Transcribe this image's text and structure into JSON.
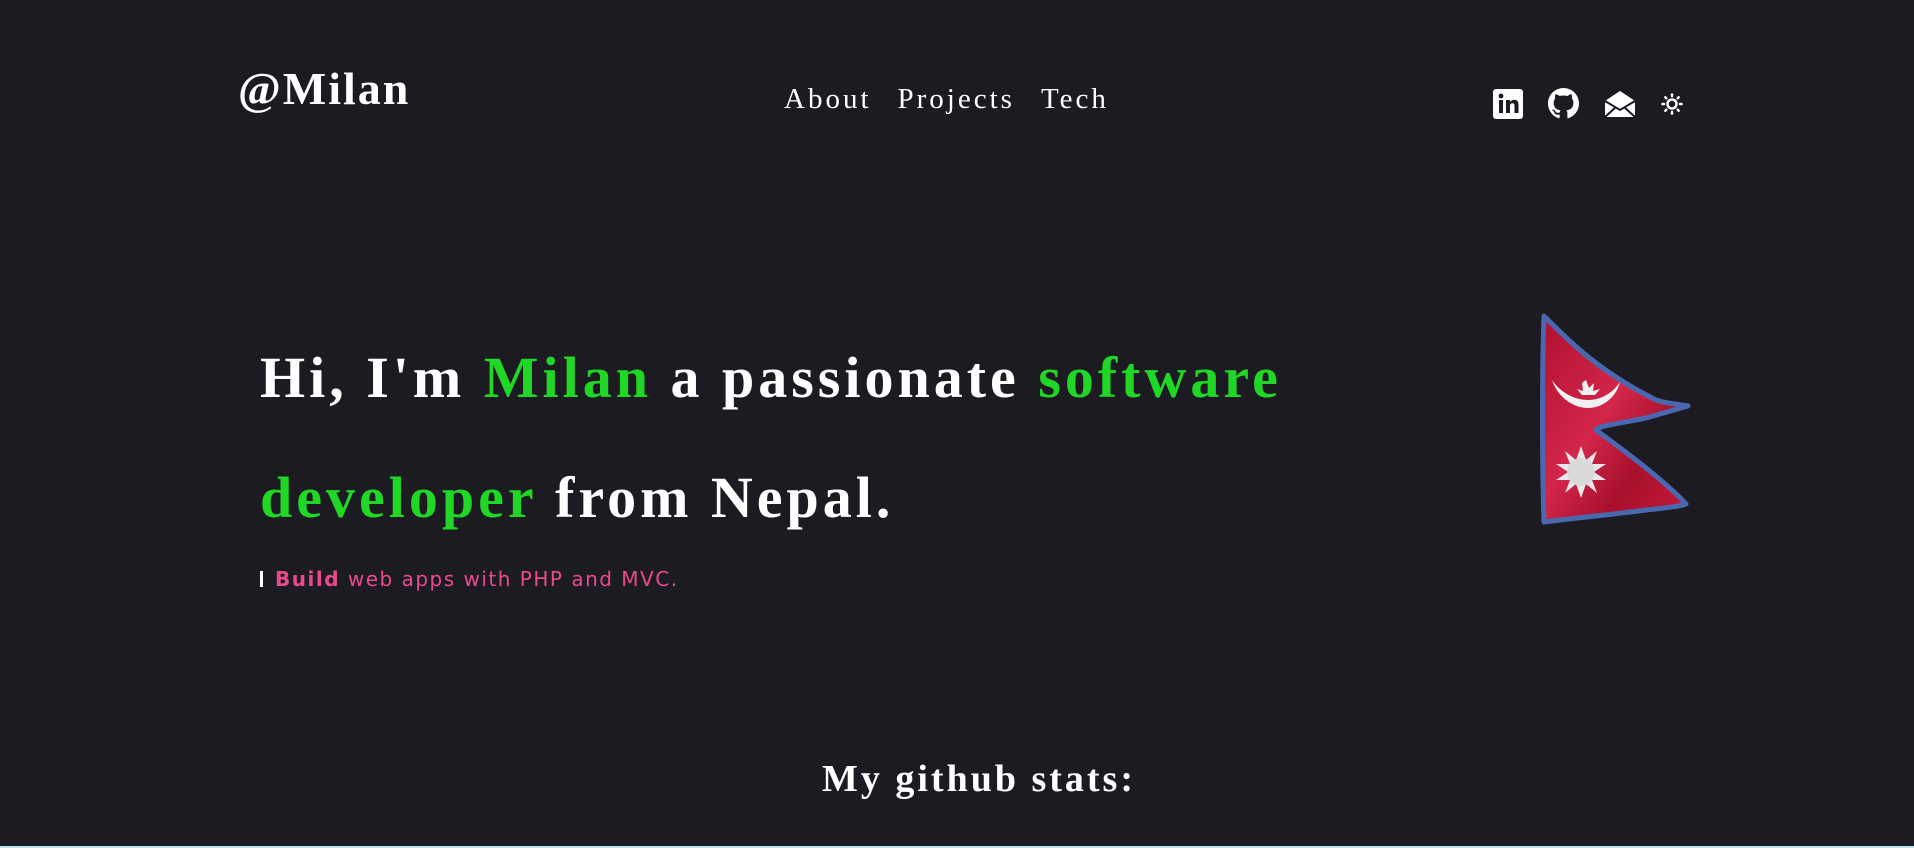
{
  "header": {
    "brand": "@Milan",
    "nav": [
      {
        "label": "About"
      },
      {
        "label": "Projects"
      },
      {
        "label": "Tech"
      }
    ],
    "social_icons": [
      "linkedin-icon",
      "github-icon",
      "mail-icon",
      "theme-toggle-sun-icon"
    ]
  },
  "hero": {
    "part1": "Hi, I'm ",
    "name": "Milan",
    "part2": " a passionate ",
    "role_word1": "software",
    "role_word2": "developer",
    "part3": " from Nepal."
  },
  "tagline": {
    "verb": "Build",
    "text": " web apps with PHP and MVC."
  },
  "flag_icon": "nepal-flag-icon",
  "stats": {
    "title": "My github stats:"
  },
  "colors": {
    "background": "#1c1b22",
    "accent_green": "#21d726",
    "accent_pink": "#e94b8a",
    "flag_red": "#c8102e",
    "flag_blue": "#3d5a9c"
  }
}
